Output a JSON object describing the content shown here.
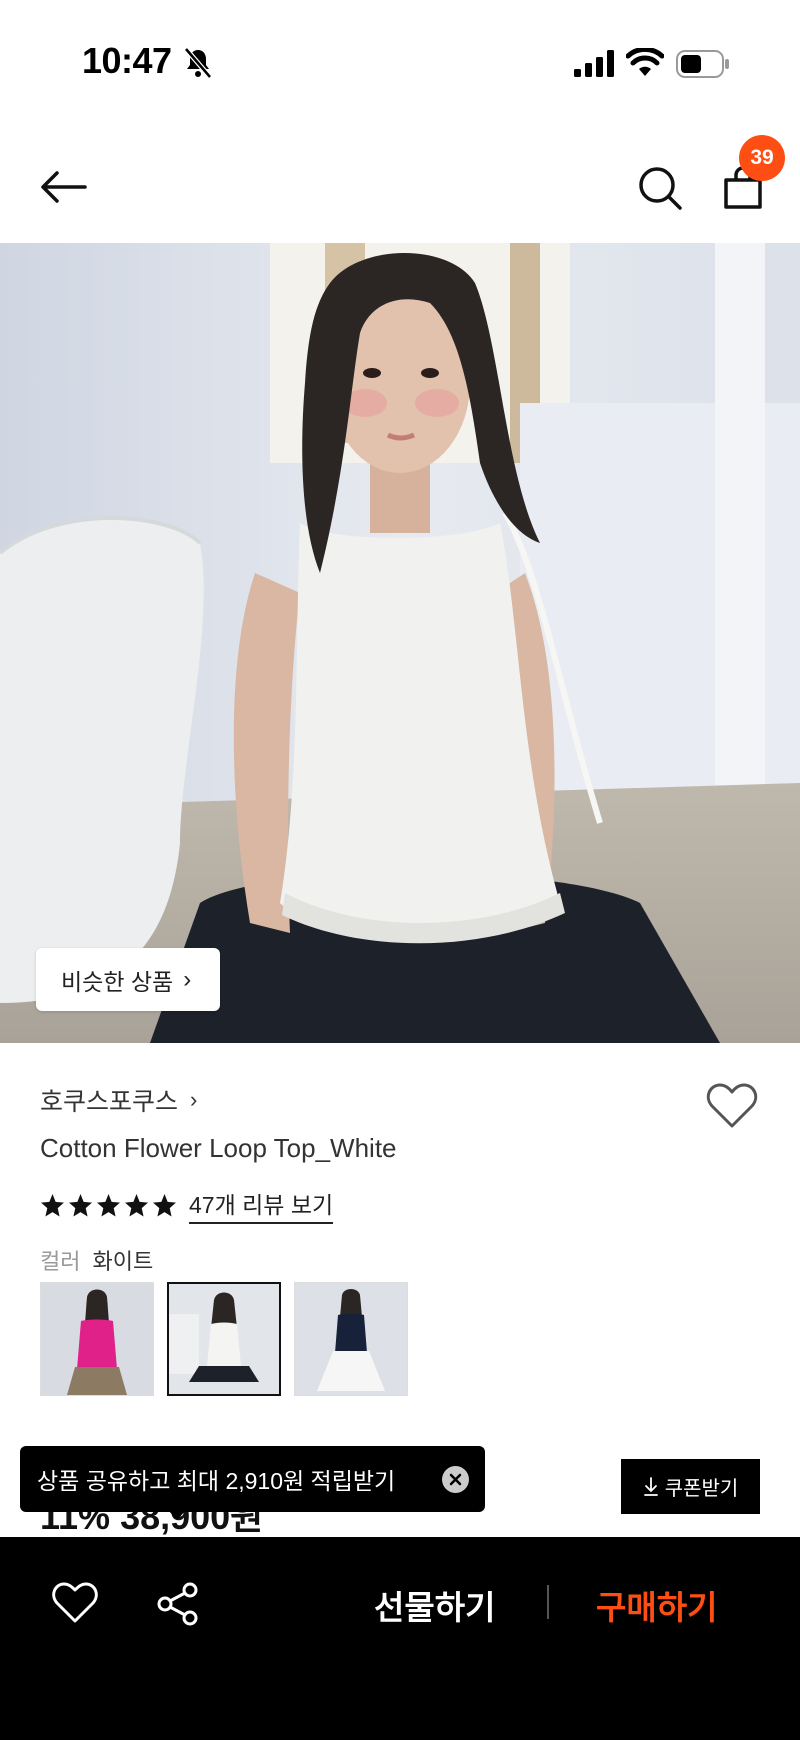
{
  "status_bar": {
    "time": "10:47",
    "icons": [
      "bell-slash-icon",
      "signal-icon",
      "wifi-icon",
      "battery-icon"
    ]
  },
  "nav": {
    "icons": [
      "arrow-left-icon",
      "search-icon",
      "shopping-bag-icon"
    ],
    "cart_count": "39"
  },
  "hero": {
    "similar_button_label": "비슷한 상품",
    "similar_button_icon": "chevron-right-icon"
  },
  "product": {
    "brand": "호쿠스포쿠스",
    "title": "Cotton Flower Loop Top_White",
    "rating_stars": 5,
    "review_link": "47개 리뷰 보기",
    "color_label": "컬러",
    "color_value": "화이트",
    "swatches": [
      {
        "name": "pink",
        "selected": false
      },
      {
        "name": "white",
        "selected": true
      },
      {
        "name": "navy",
        "selected": false
      }
    ]
  },
  "toast": {
    "text": "상품 공유하고 최대 2,910원 적립받기"
  },
  "price_peek": "11% 38,900원",
  "coupon": {
    "label": "쿠폰받기"
  },
  "bottom_bar": {
    "gift_label": "선물하기",
    "buy_label": "구매하기"
  },
  "colors": {
    "accent": "#ff4e14",
    "bar_bg": "#000000"
  }
}
